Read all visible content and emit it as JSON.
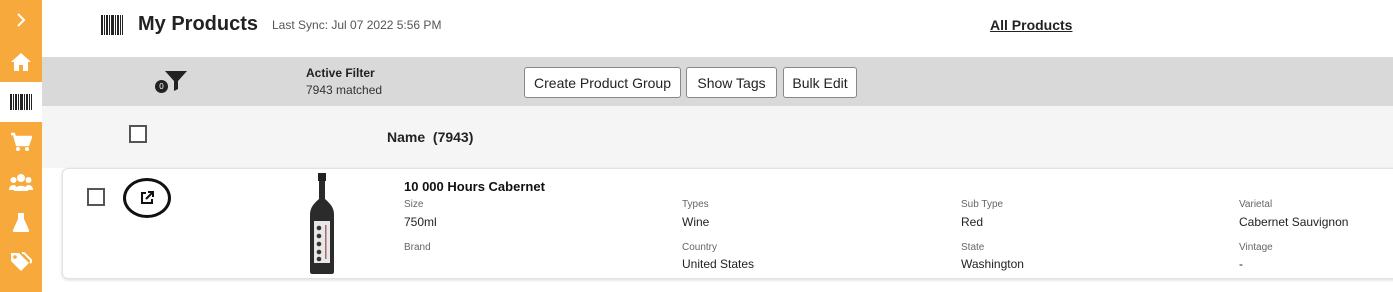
{
  "sidebar": {
    "items": [
      {
        "icon": "chevron-right-icon",
        "active": false
      },
      {
        "icon": "home-icon",
        "active": false
      },
      {
        "icon": "barcode-icon",
        "active": true
      },
      {
        "icon": "cart-icon",
        "active": false
      },
      {
        "icon": "users-icon",
        "active": false
      },
      {
        "icon": "flask-icon",
        "active": false
      },
      {
        "icon": "tags-icon",
        "active": false
      }
    ],
    "color": "#f7a93b"
  },
  "header": {
    "title": "My Products",
    "last_sync": "Last Sync: Jul 07 2022 5:56 PM",
    "all_products_link": "All Products"
  },
  "filterbar": {
    "filter_count": "0",
    "active_filter_label": "Active Filter",
    "matched": "7943 matched",
    "buttons": {
      "create_group": "Create Product Group",
      "show_tags": "Show Tags",
      "bulk_edit": "Bulk Edit"
    }
  },
  "table": {
    "name_header": "Name  (7943)"
  },
  "product": {
    "name": "10 000 Hours Cabernet",
    "fields": {
      "size_label": "Size",
      "size": "750ml",
      "types_label": "Types",
      "types": "Wine",
      "subtype_label": "Sub Type",
      "subtype": "Red",
      "varietal_label": "Varietal",
      "varietal": "Cabernet Sauvignon",
      "brand_label": "Brand",
      "brand": "",
      "country_label": "Country",
      "country": "United States",
      "state_label": "State",
      "state": "Washington",
      "vintage_label": "Vintage",
      "vintage": "-"
    }
  }
}
